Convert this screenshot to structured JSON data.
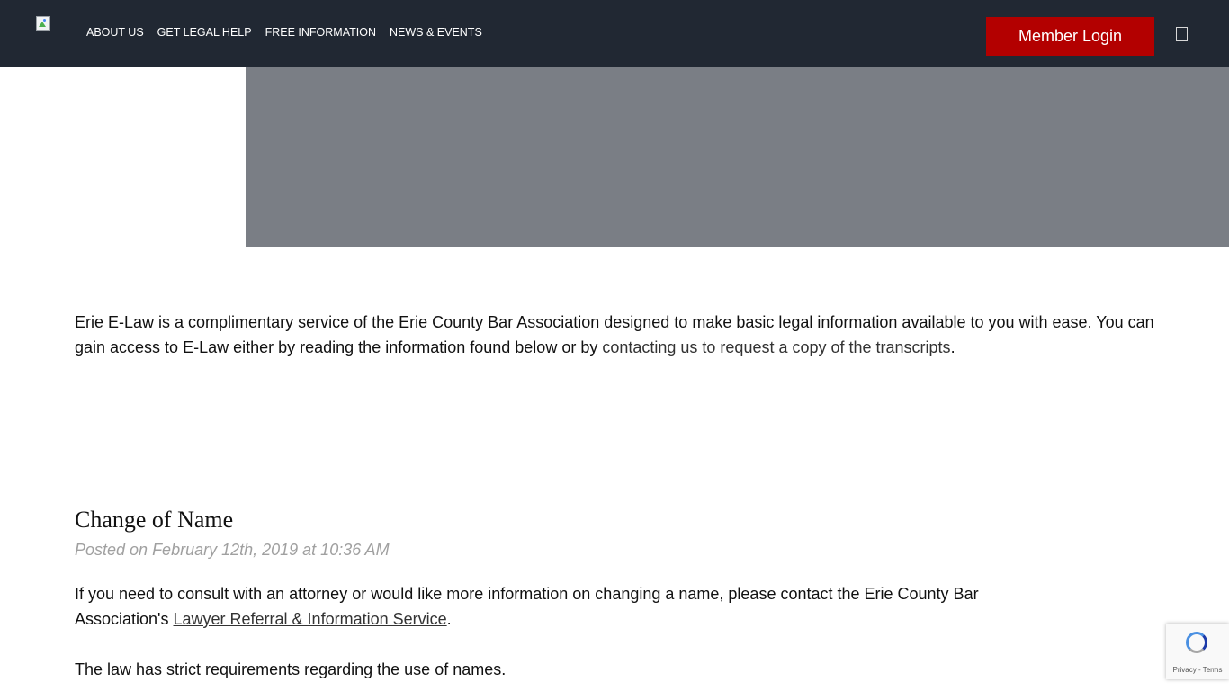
{
  "header": {
    "nav": [
      {
        "label": "ABOUT US"
      },
      {
        "label": "GET LEGAL HELP"
      },
      {
        "label": "FREE INFORMATION"
      },
      {
        "label": "NEWS & EVENTS"
      }
    ],
    "login_label": "Member Login"
  },
  "intro": {
    "text_before": "Erie E-Law is a complimentary service of the Erie County Bar Association designed to make basic legal information available to you with ease. You can gain access to E-Law either by reading the information found below or by ",
    "link": "contacting us to request a copy of the transcripts",
    "text_after": "."
  },
  "post": {
    "title": "Change of Name",
    "meta": "Posted on February 12th, 2019 at 10:36 AM",
    "para1_before": "If you need to consult with an attorney or would like more information on changing a name, please contact the Erie County Bar Association's ",
    "para1_link": "Lawyer Referral & Information Service",
    "para1_after": ".",
    "para2": "The law has strict requirements regarding the use of names."
  },
  "recaptcha": {
    "text": "Privacy - Terms"
  },
  "colors": {
    "header_bg": "#212833",
    "accent": "#b30000",
    "hero_bg": "#7a7e85",
    "meta_text": "#a0a0a0"
  }
}
